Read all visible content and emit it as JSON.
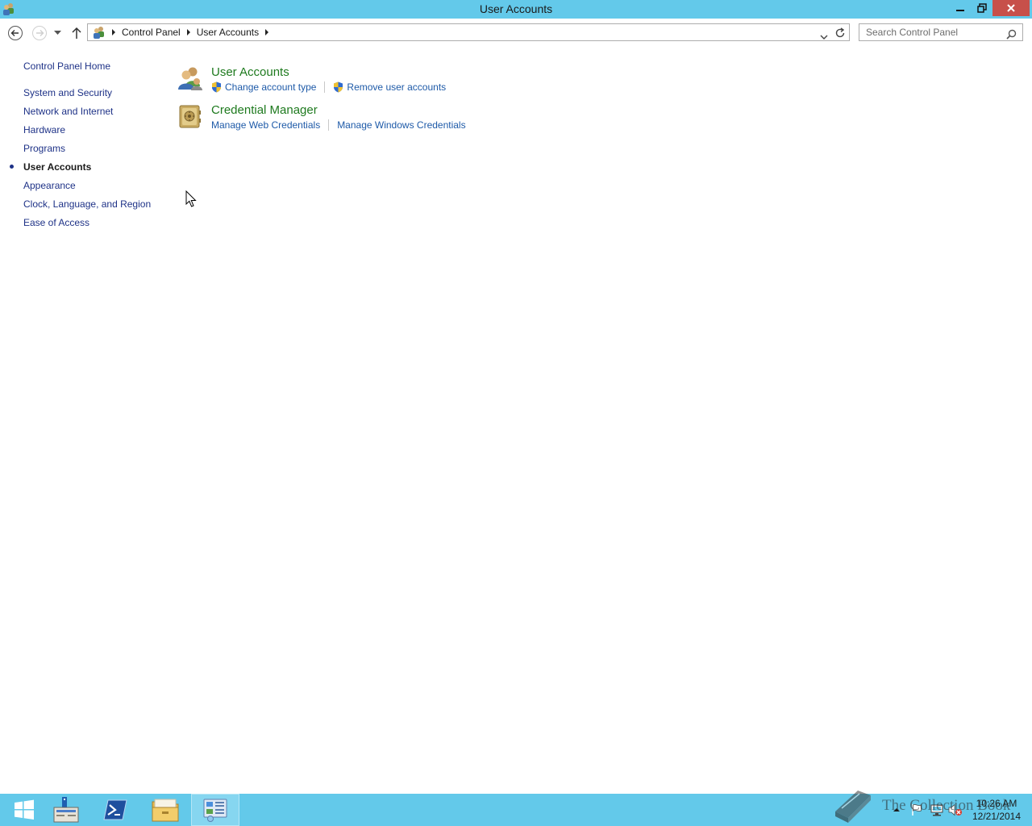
{
  "window": {
    "title": "User Accounts",
    "title_icon": "user-accounts-icon",
    "controls": [
      "minimize-icon",
      "restore-icon",
      "close-icon"
    ]
  },
  "navigation": {
    "buttons": [
      "back-icon",
      "forward-icon",
      "recent-locations-icon",
      "up-icon"
    ],
    "breadcrumb": [
      "Control Panel",
      "User Accounts"
    ],
    "search_placeholder": "Search Control Panel"
  },
  "sidebar": {
    "home": "Control Panel Home",
    "items": [
      {
        "label": "System and Security"
      },
      {
        "label": "Network and Internet"
      },
      {
        "label": "Hardware"
      },
      {
        "label": "Programs"
      },
      {
        "label": "User Accounts",
        "active": true
      },
      {
        "label": "Appearance"
      },
      {
        "label": "Clock, Language, and Region"
      },
      {
        "label": "Ease of Access"
      }
    ]
  },
  "categories": [
    {
      "title": "User Accounts",
      "icon": "users-icon",
      "links": [
        {
          "label": "Change account type",
          "icon": "shield-icon"
        },
        {
          "label": "Remove user accounts",
          "icon": "shield-icon"
        }
      ]
    },
    {
      "title": "Credential Manager",
      "icon": "vault-icon",
      "links": [
        {
          "label": "Manage Web Credentials"
        },
        {
          "label": "Manage Windows Credentials"
        }
      ]
    }
  ],
  "taskbar": {
    "apps": [
      "start-icon",
      "server-manager-icon",
      "powershell-icon",
      "file-explorer-icon",
      "control-panel-icon"
    ],
    "active_app": "control-panel-icon",
    "tray_icons": [
      "show-hidden-icons-icon",
      "action-center-flag-icon",
      "network-icon",
      "volume-muted-icon"
    ],
    "time": "10:26 AM",
    "date": "12/21/2014"
  },
  "watermark": {
    "text": "The Collection Book"
  },
  "colors": {
    "chrome": "#63c9ea",
    "category_title": "#1e7a1e",
    "link": "#1e5aa8",
    "sidebar_link": "#1e3287"
  }
}
